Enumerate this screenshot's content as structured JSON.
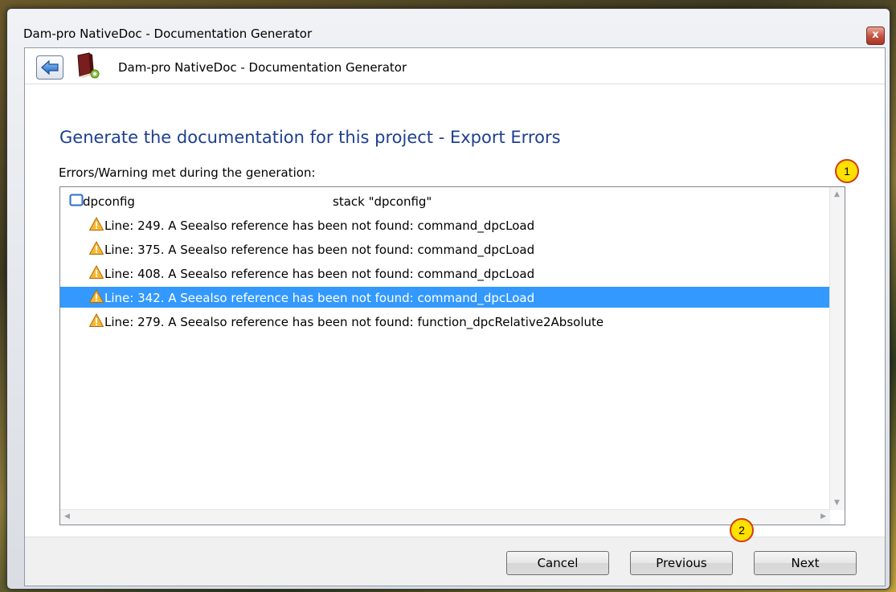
{
  "window": {
    "title": "Dam-pro NativeDoc - Documentation Generator",
    "close_glyph": "x"
  },
  "nav": {
    "title": "Dam-pro NativeDoc - Documentation Generator",
    "back_icon": "back-arrow-icon",
    "app_icon": "book-icon"
  },
  "page": {
    "heading": "Generate the documentation for this project - Export Errors",
    "list_label": "Errors/Warning met during the generation:"
  },
  "list": {
    "root": {
      "name": "dpconfig",
      "detail": "stack \"dpconfig\"",
      "icon": "stack-icon"
    },
    "items": [
      {
        "text": "Line: 249. A Seealso reference has been not found: command_dpcLoad",
        "icon": "warning-icon",
        "selected": false
      },
      {
        "text": "Line: 375. A Seealso reference has been not found: command_dpcLoad",
        "icon": "warning-icon",
        "selected": false
      },
      {
        "text": "Line: 408. A Seealso reference has been not found: command_dpcLoad",
        "icon": "warning-icon",
        "selected": false
      },
      {
        "text": "Line: 342. A Seealso reference has been not found: command_dpcLoad",
        "icon": "warning-icon",
        "selected": true
      },
      {
        "text": "Line: 279. A Seealso reference has been not found: function_dpcRelative2Absolute",
        "icon": "warning-icon",
        "selected": false
      }
    ]
  },
  "callouts": {
    "first": "1",
    "second": "2"
  },
  "buttons": {
    "cancel": "Cancel",
    "previous": "Previous",
    "next": "Next"
  },
  "colors": {
    "heading": "#1e3f8f",
    "selection": "#3399ff",
    "callout_fill": "#ffe100",
    "callout_border": "#d13b1a"
  }
}
